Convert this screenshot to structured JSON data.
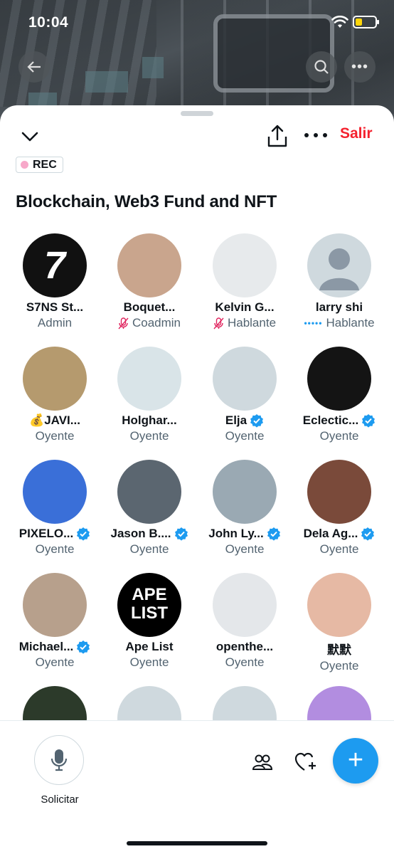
{
  "status_bar": {
    "time": "10:04"
  },
  "header": {
    "leave_label": "Salir",
    "rec_label": "REC",
    "title": "Blockchain, Web3 Fund and NFT"
  },
  "participants": [
    {
      "name": "S7NS St...",
      "role": "Admin",
      "role_icon": "",
      "verified": false,
      "avatar_color": "#111111",
      "avatar_text": "7"
    },
    {
      "name": "Boquet...",
      "role": "Coadmin",
      "role_icon": "muted-mic",
      "verified": false,
      "avatar_color": "#c9a58d",
      "avatar_text": ""
    },
    {
      "name": "Kelvin G...",
      "role": "Hablante",
      "role_icon": "muted-mic",
      "verified": false,
      "avatar_color": "#e7eaec",
      "avatar_text": ""
    },
    {
      "name": "larry shi",
      "role": "Hablante",
      "role_icon": "speaking",
      "verified": false,
      "avatar_color": "#cfd9de",
      "avatar_text": ""
    },
    {
      "name": "💰JAVI...",
      "role": "Oyente",
      "role_icon": "",
      "verified": false,
      "avatar_color": "#b59a6e",
      "avatar_text": ""
    },
    {
      "name": "Holghar...",
      "role": "Oyente",
      "role_icon": "",
      "verified": false,
      "avatar_color": "#d9e4e8",
      "avatar_text": ""
    },
    {
      "name": "Elja",
      "role": "Oyente",
      "role_icon": "",
      "verified": true,
      "avatar_color": "#cfd9de",
      "avatar_text": ""
    },
    {
      "name": "Eclectic...",
      "role": "Oyente",
      "role_icon": "",
      "verified": true,
      "avatar_color": "#141414",
      "avatar_text": ""
    },
    {
      "name": "PIXELO...",
      "role": "Oyente",
      "role_icon": "",
      "verified": true,
      "avatar_color": "#3a6fd8",
      "avatar_text": ""
    },
    {
      "name": "Jason B....",
      "role": "Oyente",
      "role_icon": "",
      "verified": true,
      "avatar_color": "#5b6670",
      "avatar_text": ""
    },
    {
      "name": "John Ly...",
      "role": "Oyente",
      "role_icon": "",
      "verified": true,
      "avatar_color": "#9aa9b3",
      "avatar_text": ""
    },
    {
      "name": "Dela Ag...",
      "role": "Oyente",
      "role_icon": "",
      "verified": true,
      "avatar_color": "#7a4a3a",
      "avatar_text": ""
    },
    {
      "name": "Michael...",
      "role": "Oyente",
      "role_icon": "",
      "verified": true,
      "avatar_color": "#b7a08c",
      "avatar_text": ""
    },
    {
      "name": "Ape List",
      "role": "Oyente",
      "role_icon": "",
      "verified": false,
      "avatar_color": "#000000",
      "avatar_text": "APE LIST"
    },
    {
      "name": "openthe...",
      "role": "Oyente",
      "role_icon": "",
      "verified": false,
      "avatar_color": "#e4e7ea",
      "avatar_text": ""
    },
    {
      "name": "默默",
      "role": "Oyente",
      "role_icon": "",
      "verified": false,
      "avatar_color": "#e6b9a4",
      "avatar_text": ""
    },
    {
      "name": "",
      "role": "",
      "role_icon": "",
      "verified": false,
      "avatar_color": "#2c3a2a",
      "avatar_text": ""
    },
    {
      "name": "",
      "role": "",
      "role_icon": "",
      "verified": false,
      "avatar_color": "#cfd9de",
      "avatar_text": ""
    },
    {
      "name": "",
      "role": "",
      "role_icon": "",
      "verified": false,
      "avatar_color": "#cfd9de",
      "avatar_text": ""
    },
    {
      "name": "",
      "role": "",
      "role_icon": "",
      "verified": false,
      "avatar_color": "#b28de0",
      "avatar_text": ""
    }
  ],
  "bottom_bar": {
    "request_label": "Solicitar",
    "fab_symbol": "+"
  },
  "colors": {
    "accent": "#1d9bf0",
    "leave": "#f4212e",
    "rec_dot": "#f7a8c9"
  }
}
